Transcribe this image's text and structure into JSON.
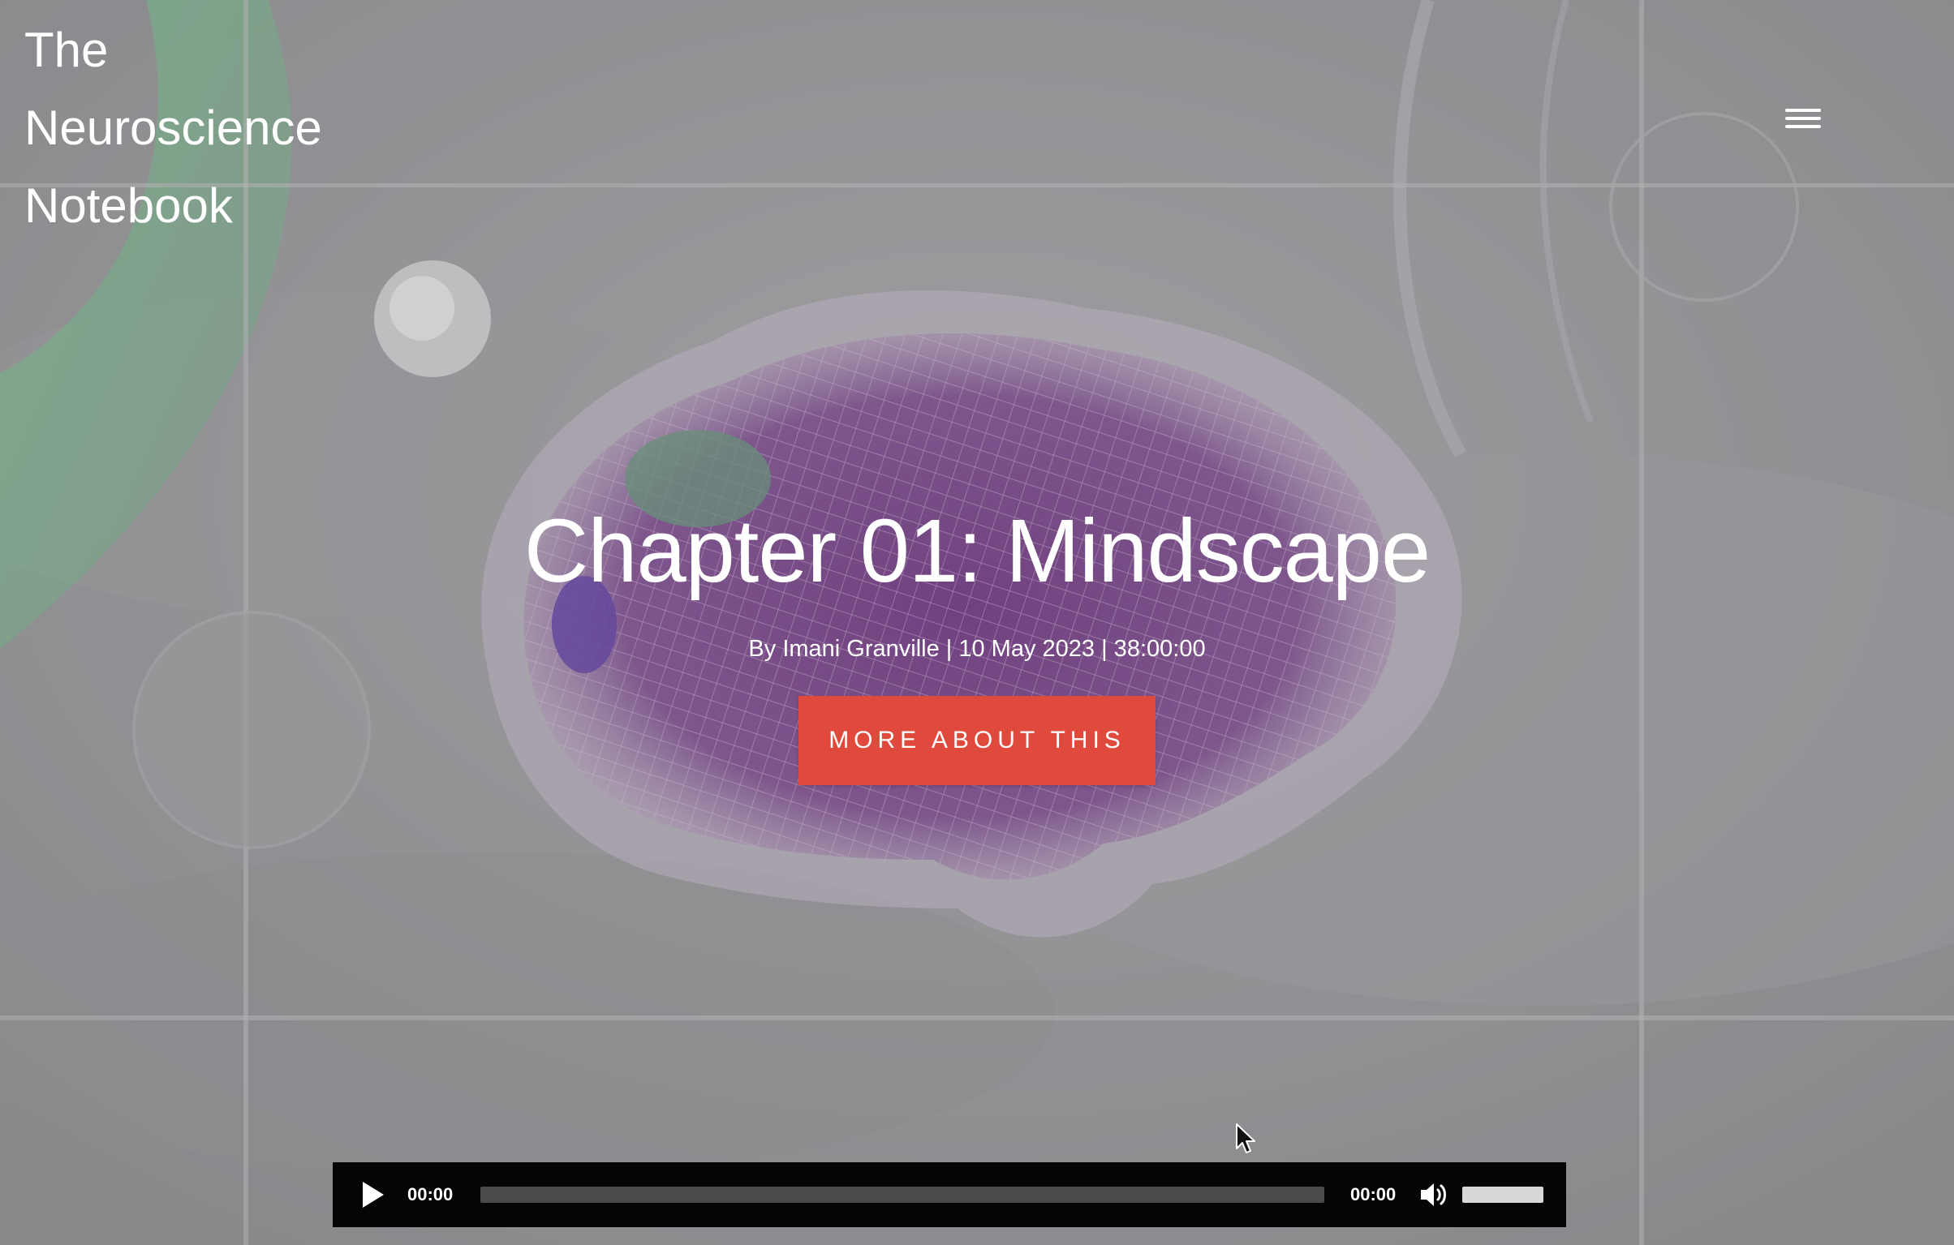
{
  "header": {
    "site_title": "The Neuroscience Notebook",
    "menu_icon": "hamburger-menu-icon"
  },
  "hero": {
    "title": "Chapter 01: Mindscape",
    "meta": "By Imani Granville | 10 May 2023 | 38:00:00",
    "cta_label": "MORE ABOUT THIS"
  },
  "audio_player": {
    "current_time": "00:00",
    "total_time": "00:00",
    "progress": 0,
    "volume": 1.0,
    "play_icon": "play-icon",
    "volume_icon": "speaker-icon"
  },
  "colors": {
    "cta_background": "#df4a3d",
    "player_background": "#050505",
    "page_background": "#8f8f93"
  }
}
